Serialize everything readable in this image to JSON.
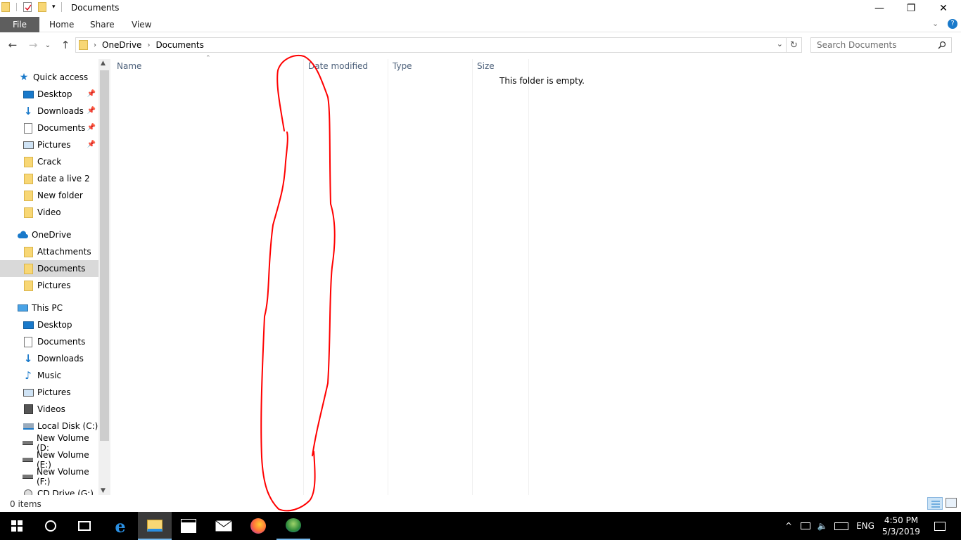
{
  "window": {
    "title": "Documents",
    "minimize_glyph": "—",
    "maximize_glyph": "❐",
    "close_glyph": "✕"
  },
  "ribbon": {
    "tabs": [
      "File",
      "Home",
      "Share",
      "View"
    ]
  },
  "address": {
    "path": [
      "OneDrive",
      "Documents"
    ],
    "search_placeholder": "Search Documents"
  },
  "navpane": {
    "items": [
      {
        "label": "Quick access",
        "icon": "star-icon",
        "level": 0
      },
      {
        "label": "Desktop",
        "icon": "desktop-icon",
        "level": 1,
        "pinned": true
      },
      {
        "label": "Downloads",
        "icon": "download-icon",
        "level": 1,
        "pinned": true
      },
      {
        "label": "Documents",
        "icon": "documents-icon",
        "level": 1,
        "pinned": true
      },
      {
        "label": "Pictures",
        "icon": "pictures-icon",
        "level": 1,
        "pinned": true
      },
      {
        "label": "Crack",
        "icon": "folder-icon",
        "level": 1
      },
      {
        "label": "date a live 2",
        "icon": "folder-icon",
        "level": 1
      },
      {
        "label": "New folder",
        "icon": "folder-icon",
        "level": 1
      },
      {
        "label": "Video",
        "icon": "folder-icon",
        "level": 1
      },
      {
        "label": "OneDrive",
        "icon": "cloud-icon",
        "level": 0
      },
      {
        "label": "Attachments",
        "icon": "folder-icon",
        "level": 1
      },
      {
        "label": "Documents",
        "icon": "folder-icon",
        "level": 1,
        "selected": true
      },
      {
        "label": "Pictures",
        "icon": "folder-icon",
        "level": 1
      },
      {
        "label": "This PC",
        "icon": "computer-icon",
        "level": 0
      },
      {
        "label": "Desktop",
        "icon": "desktop-icon",
        "level": 1
      },
      {
        "label": "Documents",
        "icon": "documents-icon",
        "level": 1
      },
      {
        "label": "Downloads",
        "icon": "download-icon",
        "level": 1
      },
      {
        "label": "Music",
        "icon": "music-icon",
        "level": 1
      },
      {
        "label": "Pictures",
        "icon": "pictures-icon",
        "level": 1
      },
      {
        "label": "Videos",
        "icon": "videos-icon",
        "level": 1
      },
      {
        "label": "Local Disk (C:)",
        "icon": "windows-drive-icon",
        "level": 1
      },
      {
        "label": "New Volume (D:",
        "icon": "drive-icon",
        "level": 1
      },
      {
        "label": "New Volume (E:)",
        "icon": "drive-icon",
        "level": 1
      },
      {
        "label": "New Volume (F:)",
        "icon": "drive-icon",
        "level": 1
      },
      {
        "label": "CD Drive (G:)",
        "icon": "cd-drive-icon",
        "level": 1
      }
    ]
  },
  "content": {
    "columns": [
      "Name",
      "Date modified",
      "Type",
      "Size"
    ],
    "empty_message": "This folder is empty."
  },
  "status": {
    "item_count": "0 items"
  },
  "taskbar": {
    "language": "ENG",
    "time": "4:50 PM",
    "date": "5/3/2019"
  },
  "colors": {
    "accent": "#1979ca",
    "folder": "#f8d775",
    "selection": "#d9d9d9",
    "annotation": "#ff0000"
  }
}
